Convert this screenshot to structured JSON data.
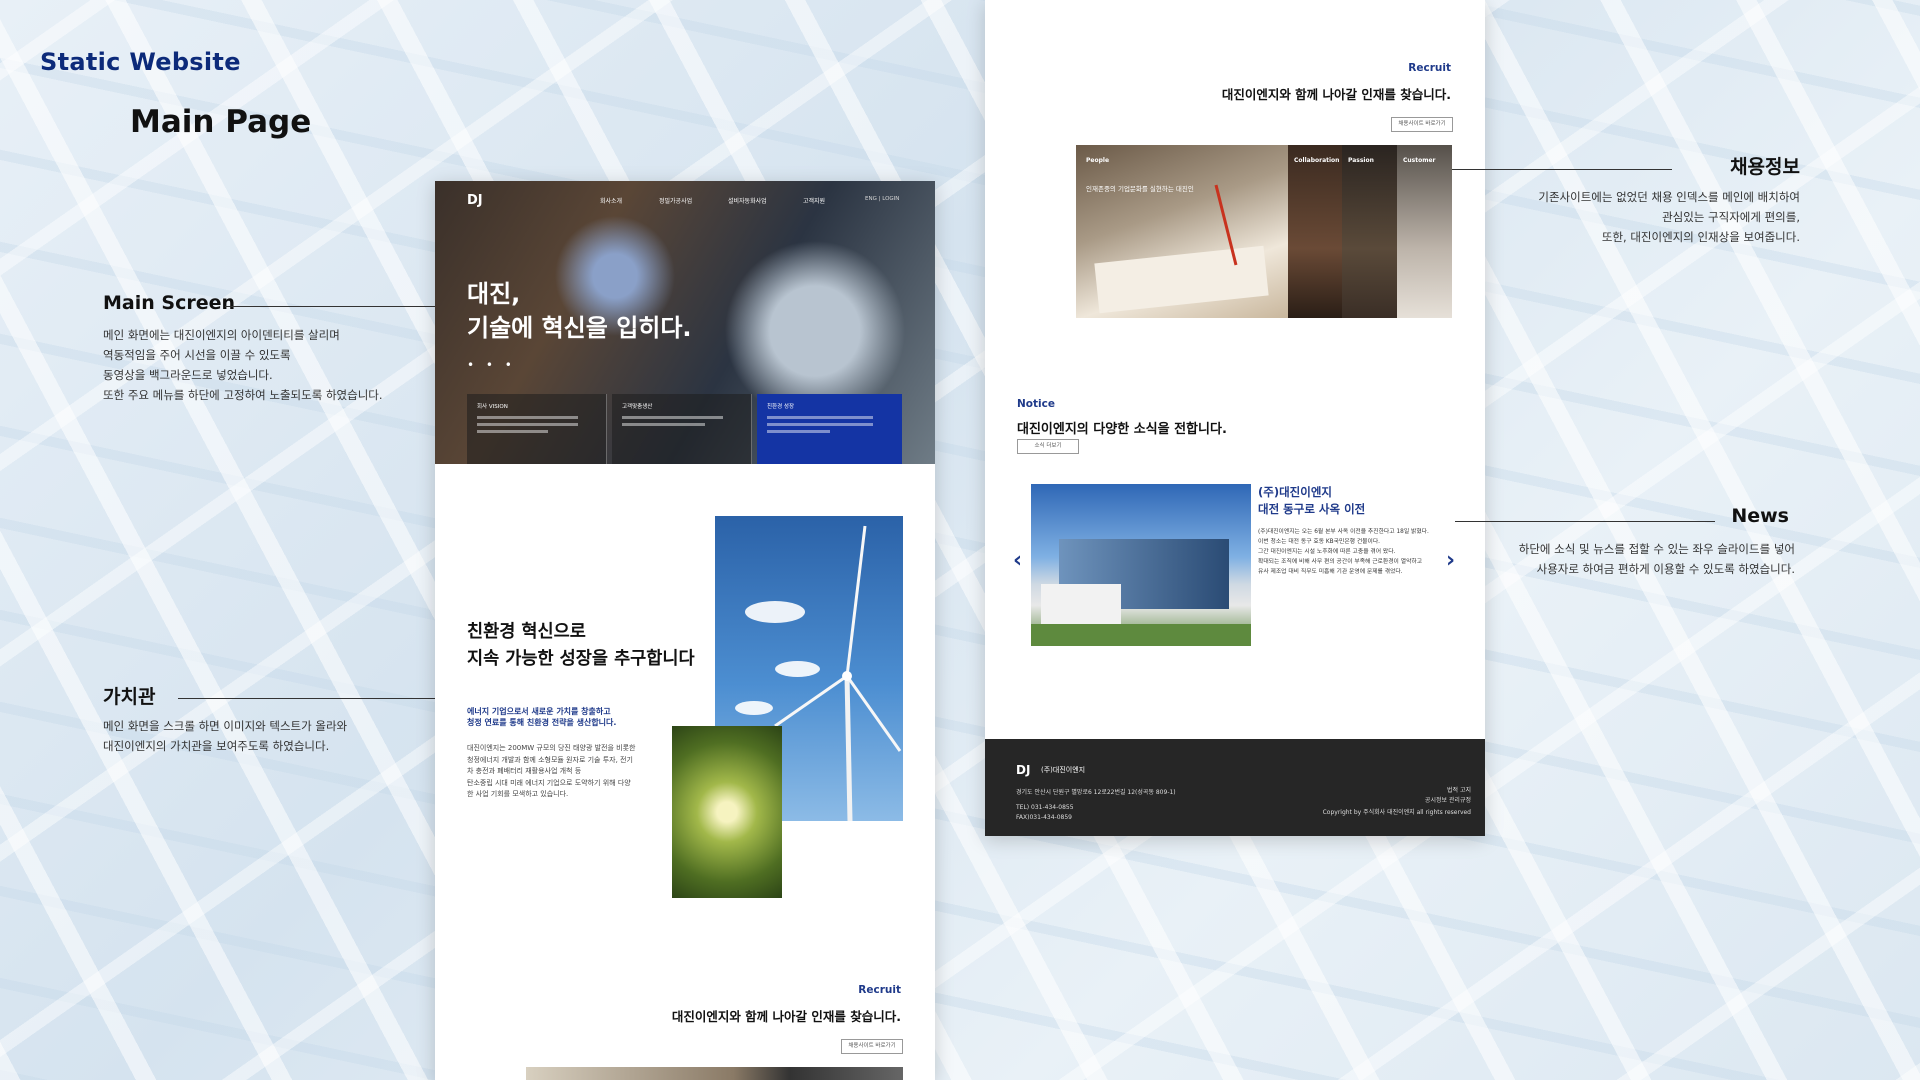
{
  "header": {
    "brand": "Static Website",
    "page_title": "Main Page"
  },
  "annotations": {
    "main_screen": {
      "title": "Main Screen",
      "lines": [
        "메인 화면에는 대진이엔지의 아이덴티티를 살리며",
        "역동적임을 주어 시선을 이끌 수 있도록",
        "동영상을 백그라운드로 넣었습니다.",
        "또한 주요 메뉴를 하단에 고정하여 노출되도록 하였습니다."
      ]
    },
    "values": {
      "title": "가치관",
      "lines": [
        "메인 화면을 스크롤 하면 이미지와 텍스트가 올라와",
        "대진이엔지의 가치관을 보여주도록 하였습니다."
      ]
    },
    "recruit_info": {
      "title": "채용정보",
      "lines": [
        "기존사이트에는 없었던 채용 인덱스를 메인에 배치하여",
        "관심있는 구직자에게 편의를,",
        "또한, 대진이엔지의 인재상을 보여줍니다."
      ]
    },
    "news": {
      "title": "News",
      "lines": [
        "하단에 소식 및 뉴스를 접할 수 있는 좌우 슬라이드를 넣어",
        "사용자로 하여금 편하게 이용할 수 있도록 하였습니다."
      ]
    }
  },
  "left_mockup": {
    "logo": "DJ",
    "nav": [
      "회사소개",
      "정밀가공사업",
      "설비자동화사업",
      "고객지원"
    ],
    "util": "ENG | LOGIN",
    "hero_line1": "대진,",
    "hero_line2": "기술에 혁신을 입히다.",
    "hero_dots": "• • •",
    "boxes": [
      {
        "title": "회사 VISION"
      },
      {
        "title": "고객맞춤생산"
      },
      {
        "title": "친환경 성장"
      }
    ],
    "eco_heading_1": "친환경 혁신으로",
    "eco_heading_2": "지속 가능한 성장을 추구합니다",
    "eco_blue_1": "에너지 기업으로서 새로운 가치를 창출하고",
    "eco_blue_2": "청정 연료를 통해 친환경 전략을 생산합니다.",
    "eco_body": [
      "대진이엔지는 200MW 규모의 당진 태양광 발전을 비롯한",
      "청정에너지 개발과 함께 소형모듈 원자로 기술 투자, 전기",
      "차 충전과 폐배터리 재활용사업 개척 등",
      "탄소중립 시대 미래 에너지 기업으로 도약하기 위해 다양",
      "한 사업 기회를 모색하고 있습니다."
    ],
    "recruit_label": "Recruit",
    "recruit_heading": "대진이엔지와 함께 나아갈 인재를 찾습니다.",
    "recruit_button": "채용사이트 바로가기"
  },
  "right_mockup": {
    "recruit_label": "Recruit",
    "recruit_heading": "대진이엔지와 함께 나아갈 인재를 찾습니다.",
    "recruit_button": "채용사이트 바로가기",
    "image_labels": [
      "People",
      "Collaboration",
      "Passion",
      "Customer"
    ],
    "image_caption": "인재존중의 기업문화를 실현하는 대진인",
    "notice_label": "Notice",
    "notice_heading": "대진이엔지의 다양한 소식을 전합니다.",
    "notice_button": "소식 더보기",
    "news_title_1": "(주)대진이엔지",
    "news_title_2": "대전 동구로 사옥 이전",
    "news_body": [
      "(주)대진이엔지는 오는 6월 본부 사옥 이전을 추진한다고 18일 밝혔다.",
      "이번 청소는 대전 동구 효동 KB국민은행 건물이다.",
      "그간 대진이엔지는 시설 노후화에 따른 고충을 겪어 왔다.",
      "확대되는 조직에 비해 사무 편의 공간이 부족해 근로환경이 열악하고",
      "유사 제조업 대비 직무도 미흡해 기관 운영에 문제를 겪었다."
    ],
    "arrow_prev": "‹",
    "arrow_next": "›",
    "footer": {
      "logo": "DJ",
      "company": "(주)대진이엔지",
      "address": "경기도 안산시 단원구 별망로6 12로22번길 12(성곡동 809-1)",
      "tel": "TEL) 031-434-0855",
      "fax": "FAX)031-434-0859",
      "link1": "법적 고지",
      "link2": "공시정보 관리규정",
      "copyright": "Copyright by 주식회사 대진이엔지 all rights reserved"
    }
  }
}
